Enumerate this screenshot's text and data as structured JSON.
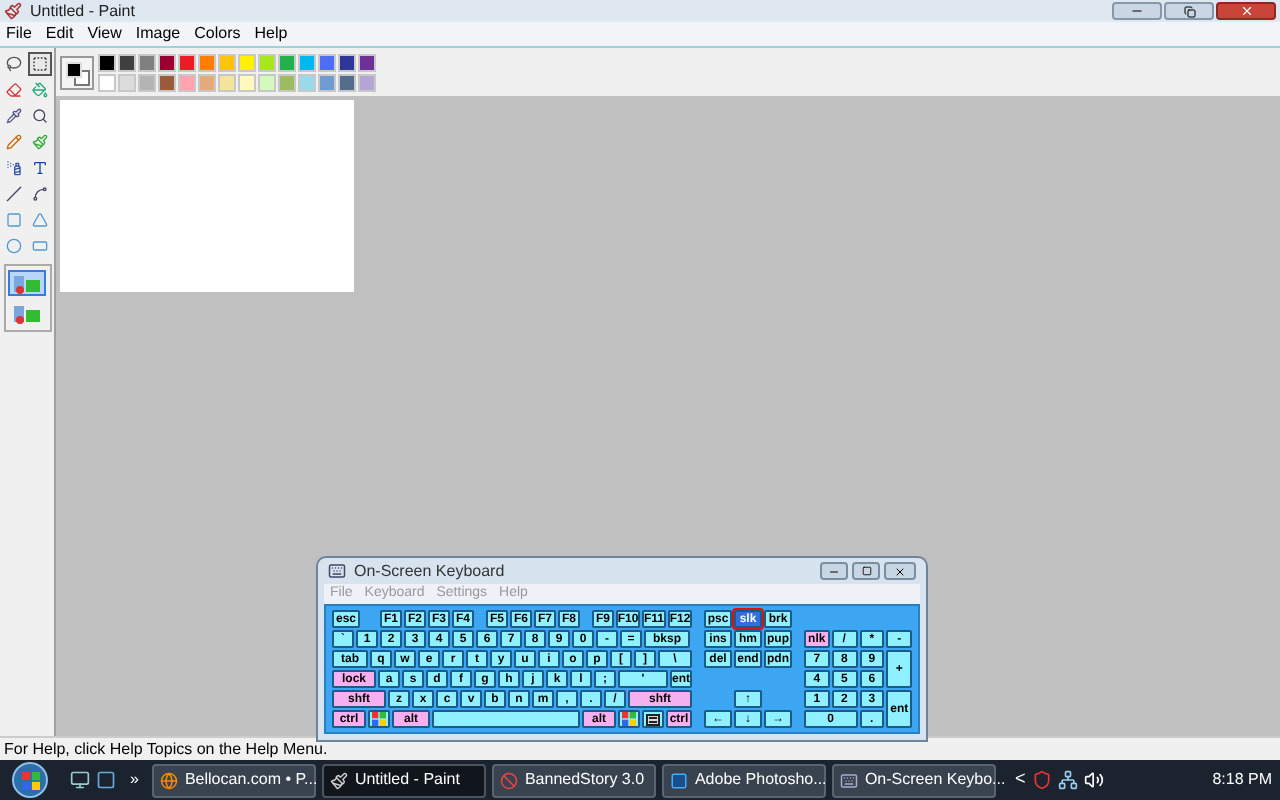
{
  "window": {
    "title": "Untitled - Paint"
  },
  "menu": [
    "File",
    "Edit",
    "View",
    "Image",
    "Colors",
    "Help"
  ],
  "tools": [
    {
      "selected": false
    },
    {
      "selected": true
    },
    {
      "selected": false
    },
    {
      "selected": false
    },
    {
      "selected": false
    },
    {
      "selected": false
    },
    {
      "selected": false
    },
    {
      "selected": false
    },
    {
      "selected": false
    },
    {
      "selected": false
    },
    {
      "selected": false
    },
    {
      "selected": false
    },
    {
      "selected": false
    },
    {
      "selected": false
    },
    {
      "selected": false
    },
    {
      "selected": false
    }
  ],
  "tool_options": [
    {
      "selected": true
    },
    {
      "selected": false
    }
  ],
  "current_colors": [
    {
      "color": "#000000"
    },
    {
      "color": "#ffffff"
    }
  ],
  "palette": [
    {
      "color": "#000000"
    },
    {
      "color": "#404040"
    },
    {
      "color": "#808080"
    },
    {
      "color": "#990030"
    },
    {
      "color": "#ed1c24"
    },
    {
      "color": "#ff7e00"
    },
    {
      "color": "#ffc20e"
    },
    {
      "color": "#fff200"
    },
    {
      "color": "#a8e61d"
    },
    {
      "color": "#22b14c"
    },
    {
      "color": "#00b7ef"
    },
    {
      "color": "#4d6df3"
    },
    {
      "color": "#2f3699"
    },
    {
      "color": "#6f3198"
    },
    {
      "color": "#ffffff"
    },
    {
      "color": "#dcdcdc"
    },
    {
      "color": "#b4b4b4"
    },
    {
      "color": "#9c5a3c"
    },
    {
      "color": "#ffa3b1"
    },
    {
      "color": "#e5aa7a"
    },
    {
      "color": "#f5e49c"
    },
    {
      "color": "#fff9bd"
    },
    {
      "color": "#d3f9bc"
    },
    {
      "color": "#9dbb61"
    },
    {
      "color": "#99d9ea"
    },
    {
      "color": "#709ad1"
    },
    {
      "color": "#546d8e"
    },
    {
      "color": "#b5a5d5"
    }
  ],
  "status_bar": "For Help, click Help Topics on the Help Menu.",
  "keyboard": {
    "title": "On-Screen Keyboard",
    "menu": [
      "File",
      "Keyboard",
      "Settings",
      "Help"
    ],
    "main_rows": [
      [
        {
          "label": "esc",
          "kind": "key",
          "selected": false
        },
        {
          "label": "F1",
          "kind": "key",
          "selected": false
        },
        {
          "label": "F2",
          "kind": "key",
          "selected": false
        },
        {
          "label": "F3",
          "kind": "key",
          "selected": false
        },
        {
          "label": "F4",
          "kind": "key",
          "selected": false
        },
        {
          "label": "F5",
          "kind": "key",
          "selected": false
        },
        {
          "label": "F6",
          "kind": "key",
          "selected": false
        },
        {
          "label": "F7",
          "kind": "key",
          "selected": false
        },
        {
          "label": "F8",
          "kind": "key",
          "selected": false
        },
        {
          "label": "F9",
          "kind": "key",
          "selected": false
        },
        {
          "label": "F10",
          "kind": "key",
          "selected": false
        },
        {
          "label": "F11",
          "kind": "key",
          "selected": false
        },
        {
          "label": "F12",
          "kind": "key",
          "selected": false
        }
      ],
      [
        {
          "label": "`",
          "kind": "key",
          "selected": false
        },
        {
          "label": "1",
          "kind": "key",
          "selected": false
        },
        {
          "label": "2",
          "kind": "key",
          "selected": false
        },
        {
          "label": "3",
          "kind": "key",
          "selected": false
        },
        {
          "label": "4",
          "kind": "key",
          "selected": false
        },
        {
          "label": "5",
          "kind": "key",
          "selected": false
        },
        {
          "label": "6",
          "kind": "key",
          "selected": false
        },
        {
          "label": "7",
          "kind": "key",
          "selected": false
        },
        {
          "label": "8",
          "kind": "key",
          "selected": false
        },
        {
          "label": "9",
          "kind": "key",
          "selected": false
        },
        {
          "label": "0",
          "kind": "key",
          "selected": false
        },
        {
          "label": "-",
          "kind": "key",
          "selected": false
        },
        {
          "label": "=",
          "kind": "key",
          "selected": false
        },
        {
          "label": "bksp",
          "kind": "key",
          "selected": false
        }
      ],
      [
        {
          "label": "tab",
          "kind": "key",
          "selected": false
        },
        {
          "label": "q",
          "kind": "key",
          "selected": false
        },
        {
          "label": "w",
          "kind": "key",
          "selected": false
        },
        {
          "label": "e",
          "kind": "key",
          "selected": false
        },
        {
          "label": "r",
          "kind": "key",
          "selected": false
        },
        {
          "label": "t",
          "kind": "key",
          "selected": false
        },
        {
          "label": "y",
          "kind": "key",
          "selected": false
        },
        {
          "label": "u",
          "kind": "key",
          "selected": false
        },
        {
          "label": "i",
          "kind": "key",
          "selected": false
        },
        {
          "label": "o",
          "kind": "key",
          "selected": false
        },
        {
          "label": "p",
          "kind": "key",
          "selected": false
        },
        {
          "label": "[",
          "kind": "key",
          "selected": false
        },
        {
          "label": "]",
          "kind": "key",
          "selected": false
        },
        {
          "label": "\\",
          "kind": "key",
          "selected": false
        }
      ],
      [
        {
          "label": "lock",
          "kind": "mod",
          "selected": false
        },
        {
          "label": "a",
          "kind": "key",
          "selected": false
        },
        {
          "label": "s",
          "kind": "key",
          "selected": false
        },
        {
          "label": "d",
          "kind": "key",
          "selected": false
        },
        {
          "label": "f",
          "kind": "key",
          "selected": false
        },
        {
          "label": "g",
          "kind": "key",
          "selected": false
        },
        {
          "label": "h",
          "kind": "key",
          "selected": false
        },
        {
          "label": "j",
          "kind": "key",
          "selected": false
        },
        {
          "label": "k",
          "kind": "key",
          "selected": false
        },
        {
          "label": "l",
          "kind": "key",
          "selected": false
        },
        {
          "label": ";",
          "kind": "key",
          "selected": false
        },
        {
          "label": "'",
          "kind": "key",
          "selected": false
        },
        {
          "label": "ent",
          "kind": "key",
          "selected": false
        }
      ],
      [
        {
          "label": "shft",
          "kind": "mod",
          "selected": false
        },
        {
          "label": "z",
          "kind": "key",
          "selected": false
        },
        {
          "label": "x",
          "kind": "key",
          "selected": false
        },
        {
          "label": "c",
          "kind": "key",
          "selected": false
        },
        {
          "label": "v",
          "kind": "key",
          "selected": false
        },
        {
          "label": "b",
          "kind": "key",
          "selected": false
        },
        {
          "label": "n",
          "kind": "key",
          "selected": false
        },
        {
          "label": "m",
          "kind": "key",
          "selected": false
        },
        {
          "label": ",",
          "kind": "key",
          "selected": false
        },
        {
          "label": ".",
          "kind": "key",
          "selected": false
        },
        {
          "label": "/",
          "kind": "key",
          "selected": false
        },
        {
          "label": "shft",
          "kind": "mod",
          "selected": false
        }
      ],
      [
        {
          "label": "ctrl",
          "kind": "mod",
          "selected": false
        },
        {
          "kind": "win",
          "selected": false
        },
        {
          "label": "alt",
          "kind": "mod",
          "selected": false
        },
        {
          "kind": "space",
          "selected": false
        },
        {
          "label": "alt",
          "kind": "mod",
          "selected": false
        },
        {
          "kind": "win",
          "selected": false
        },
        {
          "kind": "menu",
          "selected": false
        },
        {
          "label": "ctrl",
          "kind": "mod",
          "selected": false
        }
      ]
    ],
    "nav_rows": [
      [
        {
          "label": "psc",
          "kind": "key",
          "selected": false
        },
        {
          "label": "slk",
          "kind": "key",
          "selected": true
        },
        {
          "label": "brk",
          "kind": "key",
          "selected": false
        }
      ],
      [
        {
          "label": "ins",
          "kind": "key",
          "selected": false
        },
        {
          "label": "hm",
          "kind": "key",
          "selected": false
        },
        {
          "label": "pup",
          "kind": "key",
          "selected": false
        }
      ],
      [
        {
          "label": "del",
          "kind": "key",
          "selected": false
        },
        {
          "label": "end",
          "kind": "key",
          "selected": false
        },
        {
          "label": "pdn",
          "kind": "key",
          "selected": false
        }
      ],
      [],
      [
        {
          "label": "↑",
          "kind": "key",
          "selected": false
        }
      ],
      [
        {
          "label": "←",
          "kind": "key",
          "selected": false
        },
        {
          "label": "↓",
          "kind": "key",
          "selected": false
        },
        {
          "label": "→",
          "kind": "key",
          "selected": false
        }
      ]
    ],
    "numpad": [
      {
        "label": "nlk",
        "kind": "mod",
        "selected": false
      },
      {
        "label": "/",
        "kind": "key",
        "selected": false
      },
      {
        "label": "*",
        "kind": "key",
        "selected": false
      },
      {
        "label": "-",
        "kind": "key",
        "selected": false
      },
      {
        "label": "7",
        "kind": "key",
        "selected": false
      },
      {
        "label": "8",
        "kind": "key",
        "selected": false
      },
      {
        "label": "9",
        "kind": "key",
        "selected": false
      },
      {
        "label": "+",
        "kind": "tall",
        "selected": false
      },
      {
        "label": "4",
        "kind": "key",
        "selected": false
      },
      {
        "label": "5",
        "kind": "key",
        "selected": false
      },
      {
        "label": "6",
        "kind": "key",
        "selected": false
      },
      {
        "label": "1",
        "kind": "key",
        "selected": false
      },
      {
        "label": "2",
        "kind": "key",
        "selected": false
      },
      {
        "label": "3",
        "kind": "key",
        "selected": false
      },
      {
        "label": "ent",
        "kind": "tall",
        "selected": false
      },
      {
        "label": "0",
        "kind": "wide",
        "selected": false
      },
      {
        "label": ".",
        "kind": "key",
        "selected": false
      }
    ]
  },
  "taskbar": {
    "overflow": "»",
    "buttons": [
      {
        "label": "Bellocan.com • P...",
        "selected": false
      },
      {
        "label": "Untitled - Paint",
        "selected": true
      },
      {
        "label": "BannedStory 3.0",
        "selected": false
      },
      {
        "label": "Adobe Photosho...",
        "selected": false
      },
      {
        "label": "On-Screen Keybo...",
        "selected": false
      }
    ],
    "tray_arrow": "<",
    "clock": "8:18 PM"
  }
}
